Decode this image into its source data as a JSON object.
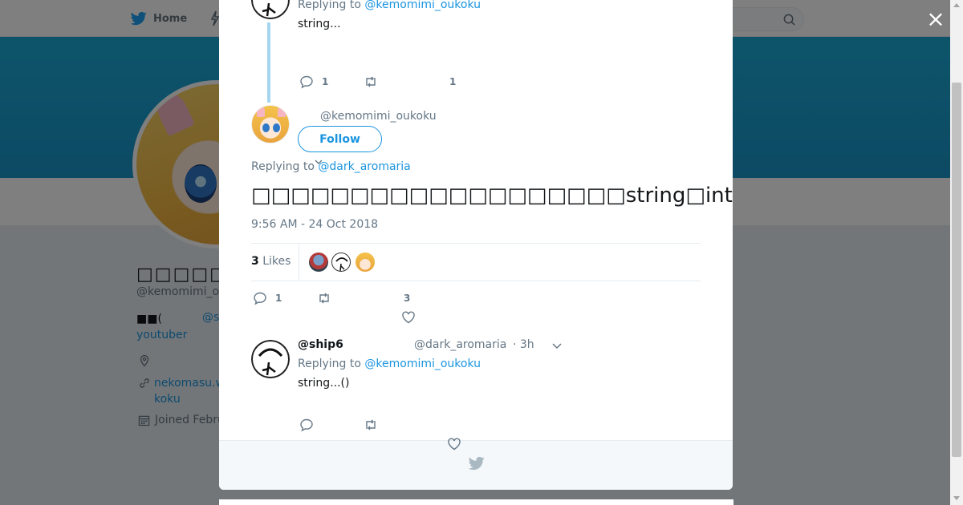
{
  "colors": {
    "brand": "#1da1f2",
    "link": "#1b95e0",
    "muted": "#657786",
    "text": "#14171a",
    "banner": "#1b94c9"
  },
  "topbar": {
    "home_label": "Home",
    "search_icon": "search-icon",
    "logo_icon": "bird-icon"
  },
  "profile_bg": {
    "name": "□□□□□□□□□",
    "handle": "@kemomimi_o",
    "bio_prefix": "■■(",
    "bio_mention": "@s",
    "bio_line2": "youtuber",
    "url_line1": "nekomasu.w",
    "url_line2": "koku",
    "joined": "Joined Febru"
  },
  "close_label": "×",
  "parent_tweet": {
    "replying_prefix": "Replying to",
    "replying_handle": "@kemomimi_oukoku",
    "text": "string...",
    "reply_count": "1",
    "like_count": "1",
    "like_partial": "--"
  },
  "main_tweet": {
    "handle": "@kemomimi_oukoku",
    "follow_label": "Follow",
    "replying_prefix": "Replying to",
    "replying_handle": "@dark_aromaria",
    "text": "□□□□□□□□□□□□□□□□□□□string□int□□□□□□□□□□□□□□□□□□□□",
    "timestamp": "9:56 AM - 24 Oct 2018",
    "likes_count": "3",
    "likes_label": "Likes",
    "reply_count": "1",
    "like_count": "3"
  },
  "reply_tweet": {
    "name": "@ship6",
    "handle": "@dark_aromaria",
    "time": "· 3h",
    "replying_prefix": "Replying to",
    "replying_handle": "@kemomimi_oukoku",
    "text": "string...()"
  }
}
